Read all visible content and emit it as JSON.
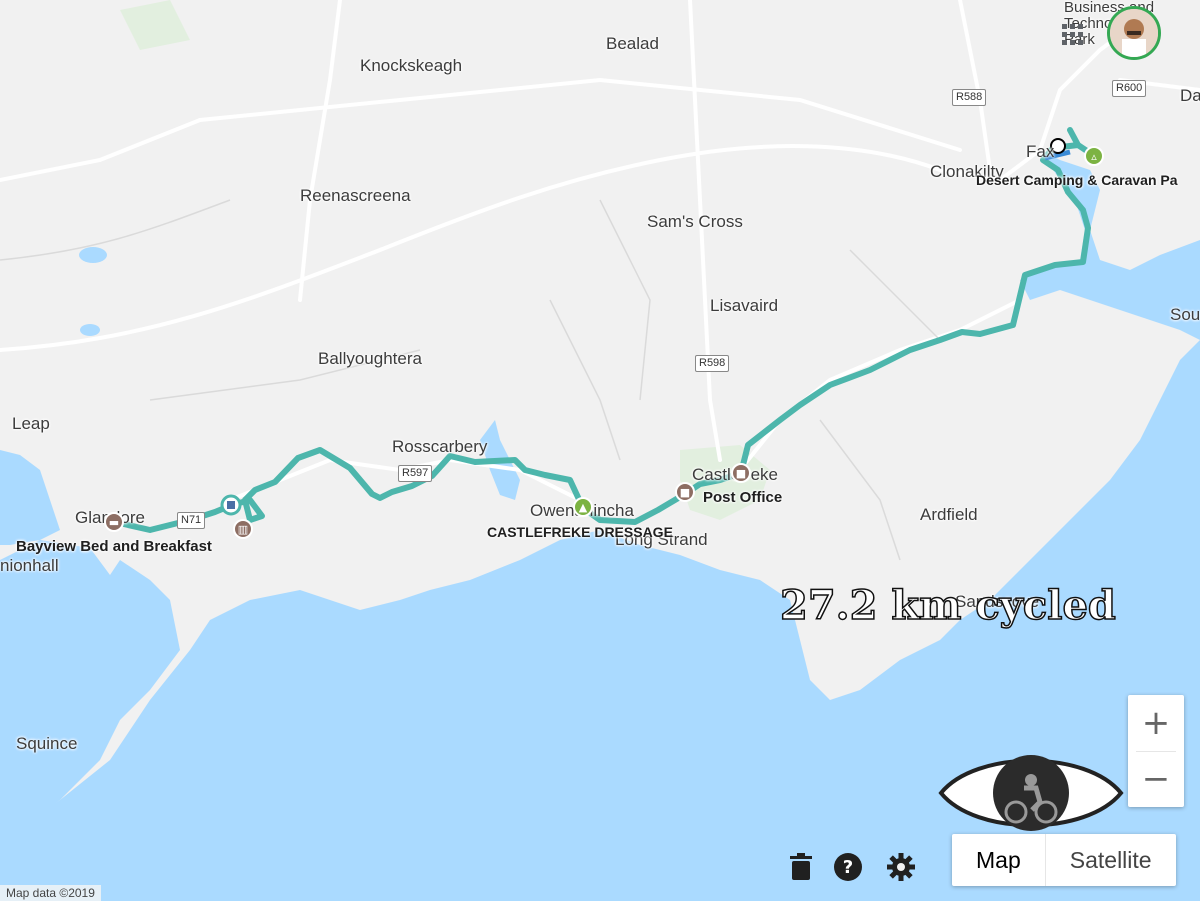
{
  "places": {
    "bealad": "Bealad",
    "knockskeagh": "Knockskeagh",
    "reenascreena": "Reenascreena",
    "sams_cross": "Sam's Cross",
    "clonakilty": "Clonakilty",
    "lisavaird": "Lisavaird",
    "ballyoughtera": "Ballyoughtera",
    "leap": "Leap",
    "rosscarbery": "Rosscarbery",
    "glandore": "Glandore",
    "owenahincha": "Owenahincha",
    "long_strand": "Long Strand",
    "castlefreke": "Castlefreke",
    "ardfield": "Ardfield",
    "sandscove": "Sandscove",
    "squince": "Squince",
    "unionhall": "nionhall",
    "faxb": "Fax",
    "business_tech": "Business and Technology Park",
    "dd": "Da",
    "sou": "Sou"
  },
  "pois": {
    "bayview": "Bayview Bed and Breakfast",
    "castlefreke_dressage": "CASTLEFREKE DRESSAGE",
    "post_office": "Post Office",
    "desert_camping": "Desert Camping & Caravan Pa"
  },
  "roads": {
    "r588": "R588",
    "r600": "R600",
    "r598": "R598",
    "r597": "R597",
    "n71": "N71"
  },
  "caption": "27.2 km cycled",
  "controls": {
    "zoom_in": "+",
    "zoom_out": "−",
    "map_label": "Map",
    "satellite_label": "Satellite"
  },
  "attribution": "Map data ©2019",
  "colors": {
    "route": "#4db6ac",
    "water": "#aadaff",
    "land": "#f1f1f1",
    "poi_brown": "#8d6e63",
    "poi_green": "#7cb342"
  },
  "icons": {
    "trash": "trash-icon",
    "help": "help-icon",
    "settings": "gear-icon",
    "apps": "apps-grid-icon"
  }
}
